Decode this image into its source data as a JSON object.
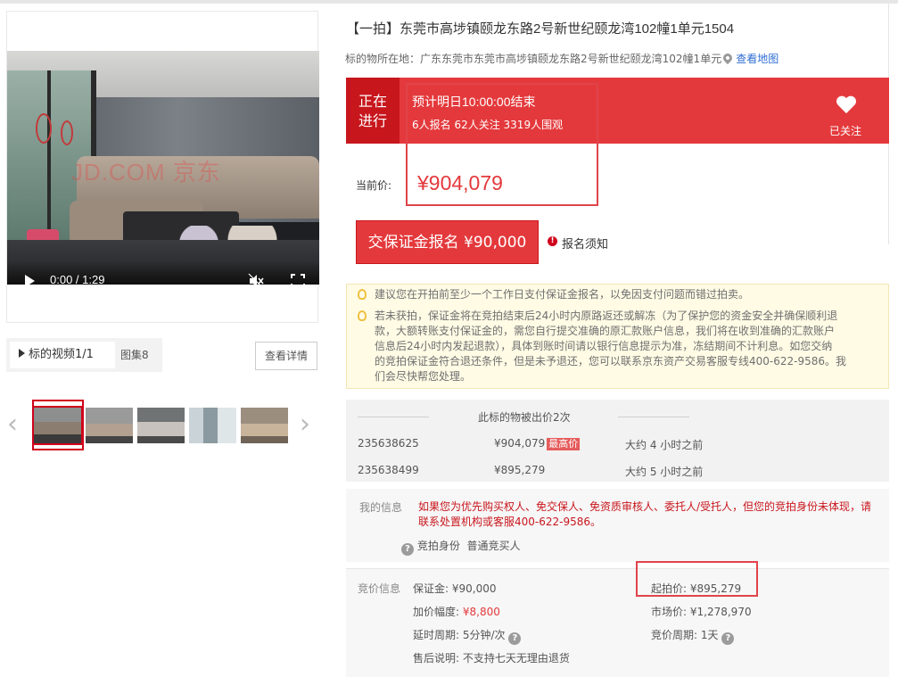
{
  "title": "【一拍】东莞市高埗镇颐龙东路2号新世纪颐龙湾102幢1单元1504",
  "location": {
    "label": "标的物所在地：",
    "address": "广东东莞市东莞市高埗镇颐龙东路2号新世纪颐龙湾102幢1单元",
    "map_link": "查看地图"
  },
  "media": {
    "watermark": "JD.COM 京东",
    "video_time": "0:00 / 1:29",
    "video_progress": 0.2,
    "tab_video": "标的视频1/1",
    "tab_album": "图集8",
    "detail_button": "查看详情",
    "thumbnails": 5
  },
  "auction": {
    "status": [
      "正在",
      "进行"
    ],
    "end_time": "预计明日10:00:00结束",
    "counts": "6人报名  62人关注  3319人围观",
    "follow_label": "已关注",
    "price_label": "当前价:",
    "current_price": "¥904,079",
    "deposit_button": "交保证金报名 ¥90,000",
    "notice_link": "报名须知"
  },
  "tips": [
    "建议您在开拍前至少一个工作日支付保证金报名，以免因支付问题而错过拍卖。",
    "若未获拍，保证金将在竞拍结束后24小时内原路返还或解冻（为了保护您的资金安全并确保顺利退",
    "款，大额转账支付保证金的，需您自行提交准确的原汇款账户信息，我们将在收到准确的汇款账户",
    "信息后24小时内发起退款），具体到账时间请以银行信息提示为准，冻结期间不计利息。如您交纳",
    "的竞拍保证金符合退还条件，但是未予退还，您可以联系京东资产交易客服专线400-622-9586。我",
    "们会尽快帮您处理。"
  ],
  "bids": {
    "header": "此标的物被出价2次",
    "rows": [
      {
        "id": "235638625",
        "price": "¥904,079",
        "tag": "最高价",
        "when": "大约 4 小时之前"
      },
      {
        "id": "235638499",
        "price": "¥895,279",
        "tag": "",
        "when": "大约 5 小时之前"
      }
    ]
  },
  "my_info": {
    "label": "我的信息",
    "warning_line1": "如果您为优先购买权人、免交保人、免资质审核人、委托人/受托人，但您的竞拍身份未体现，请",
    "warning_line2": "联系处置机构或客服400-622-9586。",
    "identity_label": "竞拍身份",
    "identity_value": "普通竞买人"
  },
  "bid_info": {
    "label": "竞价信息",
    "deposit_label": "保证金:",
    "deposit": "¥90,000",
    "increment_label": "加价幅度:",
    "increment": "¥8,800",
    "delay_label": "延时周期:",
    "delay": "5分钟/次",
    "after_sale_label": "售后说明:",
    "after_sale": "不支持七天无理由退货",
    "start_label": "起拍价:",
    "start": "¥895,279",
    "market_label": "市场价:",
    "market": "¥1,278,970",
    "cycle_label": "竞价周期:",
    "cycle": "1天"
  },
  "colors": {
    "accent": "#e4393c",
    "status_dark": "#c8161d",
    "link": "#2f6dd3"
  }
}
